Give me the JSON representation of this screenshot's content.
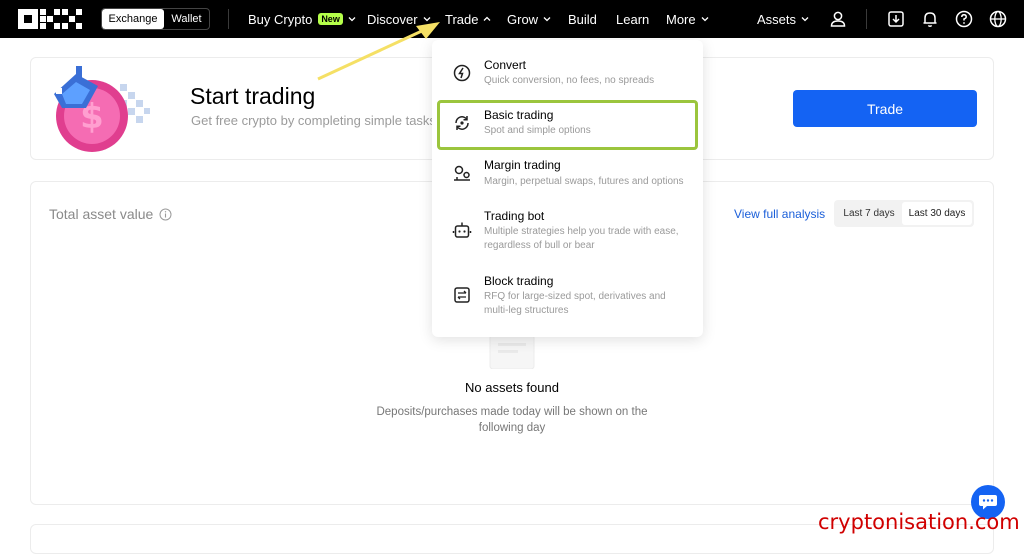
{
  "topbar": {
    "segment": {
      "exchange": "Exchange",
      "wallet": "Wallet"
    },
    "nav": {
      "buy_crypto": "Buy Crypto",
      "new_badge": "New",
      "discover": "Discover",
      "trade": "Trade",
      "grow": "Grow",
      "build": "Build",
      "learn": "Learn",
      "more": "More",
      "assets": "Assets"
    },
    "icons": [
      "profile-icon",
      "download-icon",
      "bell-icon",
      "help-icon",
      "globe-icon"
    ]
  },
  "hero": {
    "title": "Start trading",
    "subtitle": "Get free crypto by completing simple tasks",
    "trade_button": "Trade"
  },
  "assets": {
    "label": "Total asset value",
    "view_full_analysis": "View full analysis",
    "range_options": [
      "Last 7 days",
      "Last 30 days"
    ],
    "selected_range": "Last 30 days",
    "empty_title": "No assets found",
    "empty_subtitle": "Deposits/purchases made today will be shown on the following day"
  },
  "trade_menu": {
    "items": [
      {
        "title": "Convert",
        "desc": "Quick conversion, no fees, no spreads",
        "icon": "convert-icon"
      },
      {
        "title": "Basic trading",
        "desc": "Spot and simple options",
        "icon": "basic-trading-icon"
      },
      {
        "title": "Margin trading",
        "desc": "Margin, perpetual swaps, futures and options",
        "icon": "margin-trading-icon"
      },
      {
        "title": "Trading bot",
        "desc": "Multiple strategies help you trade with ease, regardless of bull or bear",
        "icon": "bot-icon"
      },
      {
        "title": "Block trading",
        "desc": "RFQ for large-sized spot, derivatives and multi-leg structures",
        "icon": "block-trading-icon"
      }
    ]
  },
  "watermark": "cryptonisation.com",
  "colors": {
    "accent": "#1463f3",
    "highlight": "#9bc53d",
    "arrow": "#f5e065",
    "watermark": "#d00000",
    "new_badge": "#b5ff4a"
  }
}
